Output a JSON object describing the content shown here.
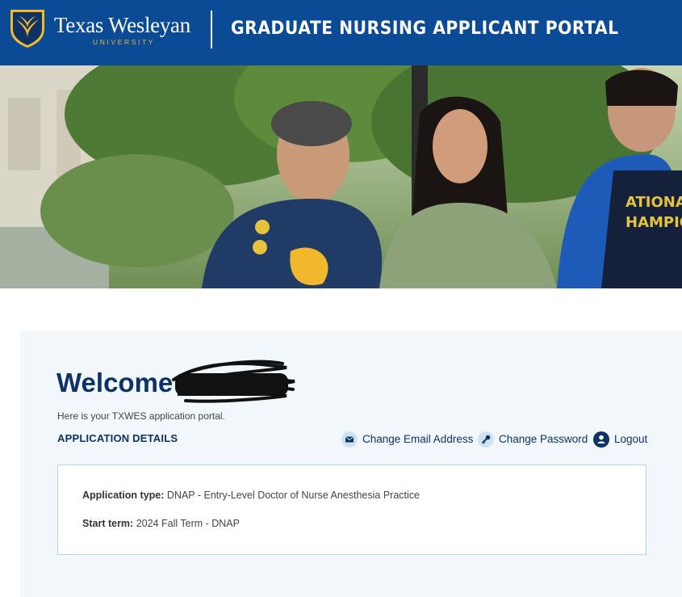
{
  "header": {
    "logo_name": "Texas Wesleyan",
    "logo_sub": "UNIVERSITY",
    "portal_title": "GRADUATE NURSING APPLICANT PORTAL"
  },
  "welcome": {
    "heading": "Welcome",
    "intro": "Here is your TXWES application portal.",
    "section_heading": "APPLICATION DETAILS"
  },
  "actions": {
    "change_email": "Change Email Address",
    "change_password": "Change Password",
    "logout": "Logout"
  },
  "details": {
    "application_type_label": "Application type:",
    "application_type_value": "DNAP - Entry-Level Doctor of Nurse Anesthesia Practice",
    "start_term_label": "Start term:",
    "start_term_value": "2024 Fall Term - DNAP"
  },
  "colors": {
    "header_blue": "#0b4a94",
    "navy": "#0d3266",
    "gold": "#f1b82d",
    "panel_bg": "#f1f7fa",
    "card_border": "#b9d6e8"
  },
  "icons": [
    "shield-logo-icon",
    "envelope-icon",
    "key-icon",
    "user-icon"
  ]
}
